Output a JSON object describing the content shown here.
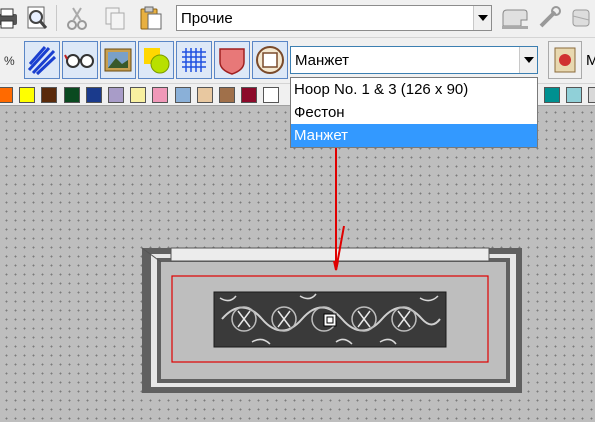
{
  "toolbar": {
    "category_combo_value": "Прочие"
  },
  "hoop_selector": {
    "current_value": "Манжет",
    "options": [
      {
        "label": "Hoop No. 1 & 3 (126 x 90)",
        "selected": false
      },
      {
        "label": "Фестон",
        "selected": false
      },
      {
        "label": "Манжет",
        "selected": true
      }
    ]
  },
  "toolbar2": {
    "left_fragment": "%",
    "right_fragment": "M"
  },
  "palette": {
    "colors": [
      "#ff6a00",
      "#ffff00",
      "#5a2a0a",
      "#0a4a20",
      "#1a3a8c",
      "#a89cc8",
      "#f8f0a0",
      "#f098b8",
      "#8ab0d8",
      "#e8c8a0",
      "#a0704a",
      "#8c0a2a",
      "#ffffff",
      "#009090",
      "#90d0d8",
      "#d8d8d8"
    ]
  },
  "colors": {
    "selection_highlight": "#3399ff",
    "hoop_boundary": "#e00000",
    "annotation_arrow": "#e00000"
  }
}
